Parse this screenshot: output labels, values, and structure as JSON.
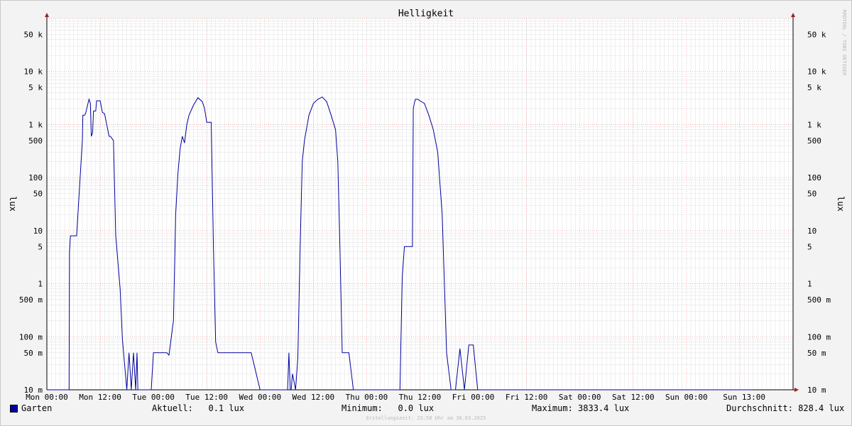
{
  "chart_data": {
    "type": "line",
    "title": "Helligkeit",
    "ylabel_left": "lux",
    "ylabel_right": "lux",
    "yscale": "log",
    "ylim": [
      0.01,
      100000
    ],
    "grid": true,
    "watermark": "RRDTOOL / TOBI OETIKER",
    "y_ticks": [
      {
        "value": 0.01,
        "label": "10 m"
      },
      {
        "value": 0.05,
        "label": "50 m"
      },
      {
        "value": 0.1,
        "label": "100 m"
      },
      {
        "value": 0.5,
        "label": "500 m"
      },
      {
        "value": 1,
        "label": "1"
      },
      {
        "value": 5,
        "label": "5"
      },
      {
        "value": 10,
        "label": "10"
      },
      {
        "value": 50,
        "label": "50"
      },
      {
        "value": 100,
        "label": "100"
      },
      {
        "value": 500,
        "label": "500"
      },
      {
        "value": 1000,
        "label": "1 k"
      },
      {
        "value": 5000,
        "label": "5 k"
      },
      {
        "value": 10000,
        "label": "10 k"
      },
      {
        "value": 50000,
        "label": "50 k"
      }
    ],
    "x_ticks": [
      "Mon 00:00",
      "Mon 12:00",
      "Tue 00:00",
      "Tue 12:00",
      "Wed 00:00",
      "Wed 12:00",
      "Thu 00:00",
      "Thu 12:00",
      "Fri 00:00",
      "Fri 12:00",
      "Sat 00:00",
      "Sat 12:00",
      "Sun 00:00",
      "Sun 13:00"
    ],
    "series": [
      {
        "name": "Garten",
        "color": "#0000a0",
        "x_hours": [
          0,
          5,
          5.1,
          5.3,
          6.5,
          6.7,
          8,
          8.1,
          8.5,
          8.7,
          9.5,
          9.8,
          10,
          10.3,
          10.5,
          11,
          11.2,
          11.5,
          12,
          12.5,
          13,
          14,
          14.3,
          15,
          15.5,
          16.5,
          17,
          18,
          18.5,
          19,
          19.5,
          20,
          20.3,
          20.5,
          20.8,
          21,
          21.3,
          21.5,
          21.8,
          22,
          22.3,
          22.5,
          22.8,
          23,
          23.3,
          23.5,
          24,
          24.3,
          26,
          26.3,
          27,
          27.5,
          28.5,
          29,
          29.5,
          30,
          30.5,
          31,
          31.5,
          32,
          33,
          34,
          35,
          35.5,
          36,
          37,
          37.5,
          38,
          38.5,
          39,
          40,
          41,
          41.5,
          42,
          42.5,
          43,
          43.5,
          44,
          46,
          48,
          50,
          52,
          52.5,
          53,
          53.5,
          54,
          54.2,
          54.5,
          54.8,
          55,
          55.3,
          56,
          56.5,
          57,
          57.5,
          58,
          59,
          60,
          61,
          62,
          63,
          64,
          65,
          65.5,
          66,
          66.5,
          67,
          67.5,
          68,
          69,
          70,
          71,
          72,
          73,
          74,
          75,
          75.5,
          76,
          76.5,
          77,
          77.5,
          78,
          78.5,
          79,
          79.5,
          80,
          80.5,
          81,
          81.3,
          81.5,
          81.8,
          82,
          82.3,
          82.5,
          82.8,
          83,
          83.3,
          83.5,
          84,
          85,
          86,
          87,
          88,
          89,
          90,
          91,
          92,
          93,
          94,
          95,
          96,
          97,
          98,
          99,
          99.5,
          100,
          100.5,
          101,
          101.5,
          102,
          102.5,
          103,
          103.5,
          104,
          104.3,
          104.5,
          104.8,
          105,
          105.3,
          105.5,
          105.8,
          106,
          106.3,
          106.5,
          106.8,
          107,
          107.3,
          107.5,
          108,
          109,
          110,
          111,
          112,
          113,
          114,
          115,
          116,
          117,
          118,
          119,
          120,
          121,
          122,
          123,
          124,
          125,
          125.5,
          126,
          126.5,
          127,
          127.5,
          128,
          128.5,
          129,
          129.2,
          129.5,
          129.8,
          130,
          130.3,
          130.5,
          130.8,
          131,
          131.3,
          131.5,
          132,
          137,
          137.5,
          138,
          139,
          140,
          141,
          141.5,
          142,
          143,
          144,
          145,
          146,
          147,
          148,
          149,
          150,
          151,
          151.5,
          152,
          152.5,
          153,
          153.5,
          154,
          154.2,
          154.5,
          154.8,
          155,
          155.5,
          156,
          156.3,
          156.5,
          157,
          157.5,
          158,
          158.5,
          159
        ],
        "values": [
          0.01,
          0.01,
          4,
          8,
          8,
          8,
          500,
          1500,
          1500,
          1600,
          3000,
          2500,
          600,
          700,
          1800,
          1800,
          2800,
          2800,
          2800,
          1700,
          1600,
          600,
          600,
          500,
          8,
          0.8,
          0.09,
          0.01,
          0.05,
          0.01,
          0.05,
          0.01,
          0.05,
          0.01,
          0.01,
          0.01,
          0.01,
          0.01,
          0.01,
          0.01,
          0.01,
          0.01,
          0.01,
          0.01,
          0.01,
          0.01,
          0.05,
          0.05,
          0.05,
          0.05,
          0.05,
          0.045,
          0.2,
          20,
          120,
          350,
          600,
          450,
          1000,
          1500,
          2300,
          3200,
          2700,
          2000,
          1100,
          1100,
          5,
          0.08,
          0.05,
          0.05,
          0.05,
          0.05,
          0.05,
          0.05,
          0.05,
          0.05,
          0.05,
          0.05,
          0.05,
          0.01,
          0.01,
          0.01,
          0.01,
          0.01,
          0.01,
          0.01,
          0.01,
          0.05,
          0.01,
          0.01,
          0.02,
          0.01,
          0.04,
          4,
          200,
          500,
          1500,
          2500,
          3000,
          3300,
          2700,
          1500,
          800,
          200,
          4,
          0.05,
          0.05,
          0.05,
          0.05,
          0.01,
          0.01,
          0.01,
          0.01,
          0.01,
          0.01,
          0.01,
          0.01,
          0.01,
          0.01,
          0.01,
          0.01,
          0.01,
          0.01,
          0.01,
          0.01,
          1.3,
          5,
          5,
          5,
          5,
          5,
          5,
          5,
          2000,
          2700,
          3000,
          3000,
          3000,
          2800,
          2500,
          1500,
          800,
          300,
          20,
          0.05,
          0.01,
          0.01,
          0.06,
          0.01,
          0.07,
          0.07,
          0.01,
          0.01,
          0.01,
          0.01,
          0.01,
          0.01,
          0.01,
          0.01,
          0.01,
          0.01,
          0.01,
          0.01,
          0.01,
          0.01,
          0.01,
          0.01,
          0.01,
          0.01,
          0.01,
          0.01,
          0.01,
          0.01,
          0.01,
          0.01,
          0.01,
          0.01,
          0.01,
          0.01,
          0.01,
          0.01,
          0.01,
          0.01,
          0.01,
          0.01,
          0.01,
          0.01,
          0.01,
          0.01,
          0.01,
          0.01,
          0.01,
          0.01,
          0.01,
          0.01,
          0.01,
          0.01,
          0.01,
          0.01,
          0.01,
          0.01,
          0.01,
          0.01,
          0.01,
          0.01,
          0.01,
          0.01,
          0.01,
          0.01,
          0.01,
          0.01,
          0.01,
          0.01,
          0.01,
          0.01,
          0.01,
          0.01,
          0.01,
          0.01,
          0.01,
          0.01,
          0.01,
          0.01,
          0.01,
          0.01,
          0.01,
          0.01,
          0.01,
          0.01,
          0.01,
          0.01,
          0.01,
          0.01,
          0.01,
          0.01,
          0.01,
          0.01,
          0.01,
          0.01,
          0.01,
          0.01,
          0.01,
          0.01,
          0.01,
          0.01,
          0.01,
          0.01,
          0.01,
          0.01,
          0.01,
          0.01,
          0.01,
          0.01,
          0.01,
          0.01,
          0.01,
          0.01,
          0.01,
          0.01,
          0.01,
          0.01,
          0.01,
          0.01,
          0.01,
          0.01,
          0.01,
          0.01,
          0.01,
          0.01,
          0.01,
          0.01,
          0.01
        ]
      }
    ]
  },
  "legend": {
    "series_name": "Garten",
    "aktuell": "Aktuell:   0.1 lux",
    "minimum": "Minimum:   0.0 lux",
    "maximum": "Maximum: 3833.4 lux",
    "durchschnitt": "Durchschnitt: 828.4 lux"
  },
  "footer": {
    "created": "Erstellungszeit: 23:58 Uhr am 30.03.2025"
  }
}
